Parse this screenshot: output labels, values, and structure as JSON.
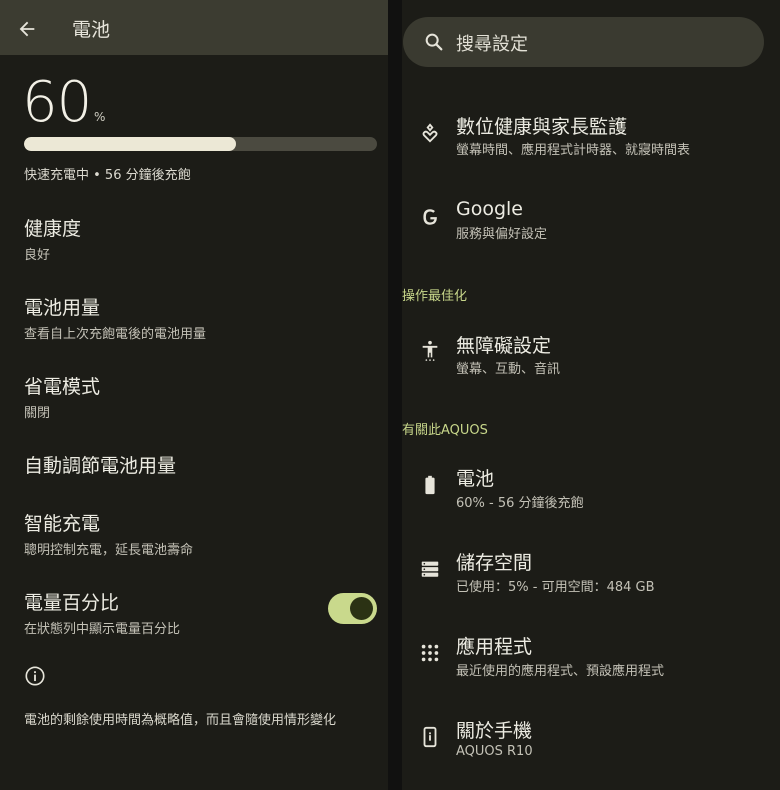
{
  "left": {
    "title": "電池",
    "battery_percent": "60",
    "percent_symbol": "%",
    "battery_level": 0.6,
    "charge_status": "快速充電中 • 56 分鐘後充飽",
    "items": [
      {
        "title": "健康度",
        "subtitle": "良好"
      },
      {
        "title": "電池用量",
        "subtitle": "查看自上次充飽電後的電池用量"
      },
      {
        "title": "省電模式",
        "subtitle": "關閉"
      },
      {
        "title": "自動調節電池用量",
        "subtitle": ""
      },
      {
        "title": "智能充電",
        "subtitle": "聰明控制充電，延長電池壽命"
      },
      {
        "title": "電量百分比",
        "subtitle": "在狀態列中顯示電量百分比"
      }
    ],
    "percentage_toggle_on": true,
    "footnote": "電池的剩餘使用時間為概略值，而且會隨使用情形變化"
  },
  "right": {
    "search_placeholder": "搜尋設定",
    "items_top": [
      {
        "icon": "digital-wellbeing-icon",
        "title": "數位健康與家長監護",
        "subtitle": "螢幕時間、應用程式計時器、就寢時間表"
      },
      {
        "icon": "google-icon",
        "title": "Google",
        "subtitle": "服務與偏好設定"
      }
    ],
    "section_optimize": "操作最佳化",
    "accessibility": {
      "icon": "accessibility-icon",
      "title": "無障礙設定",
      "subtitle": "螢幕、互動、音訊"
    },
    "section_about": "有關此AQUOS",
    "items_about": [
      {
        "icon": "battery-icon",
        "title": "電池",
        "subtitle": "60% - 56 分鐘後充飽"
      },
      {
        "icon": "storage-icon",
        "title": "儲存空間",
        "subtitle": "已使用：5% - 可用空間：484 GB"
      },
      {
        "icon": "apps-icon",
        "title": "應用程式",
        "subtitle": "最近使用的應用程式、預設應用程式"
      },
      {
        "icon": "phone-info-icon",
        "title": "關於手機",
        "subtitle": "AQUOS R10"
      }
    ]
  },
  "colors": {
    "background": "#1c1c17",
    "header": "#3c3c31",
    "accent": "#c9d98c",
    "section_label": "#c7d68a"
  }
}
